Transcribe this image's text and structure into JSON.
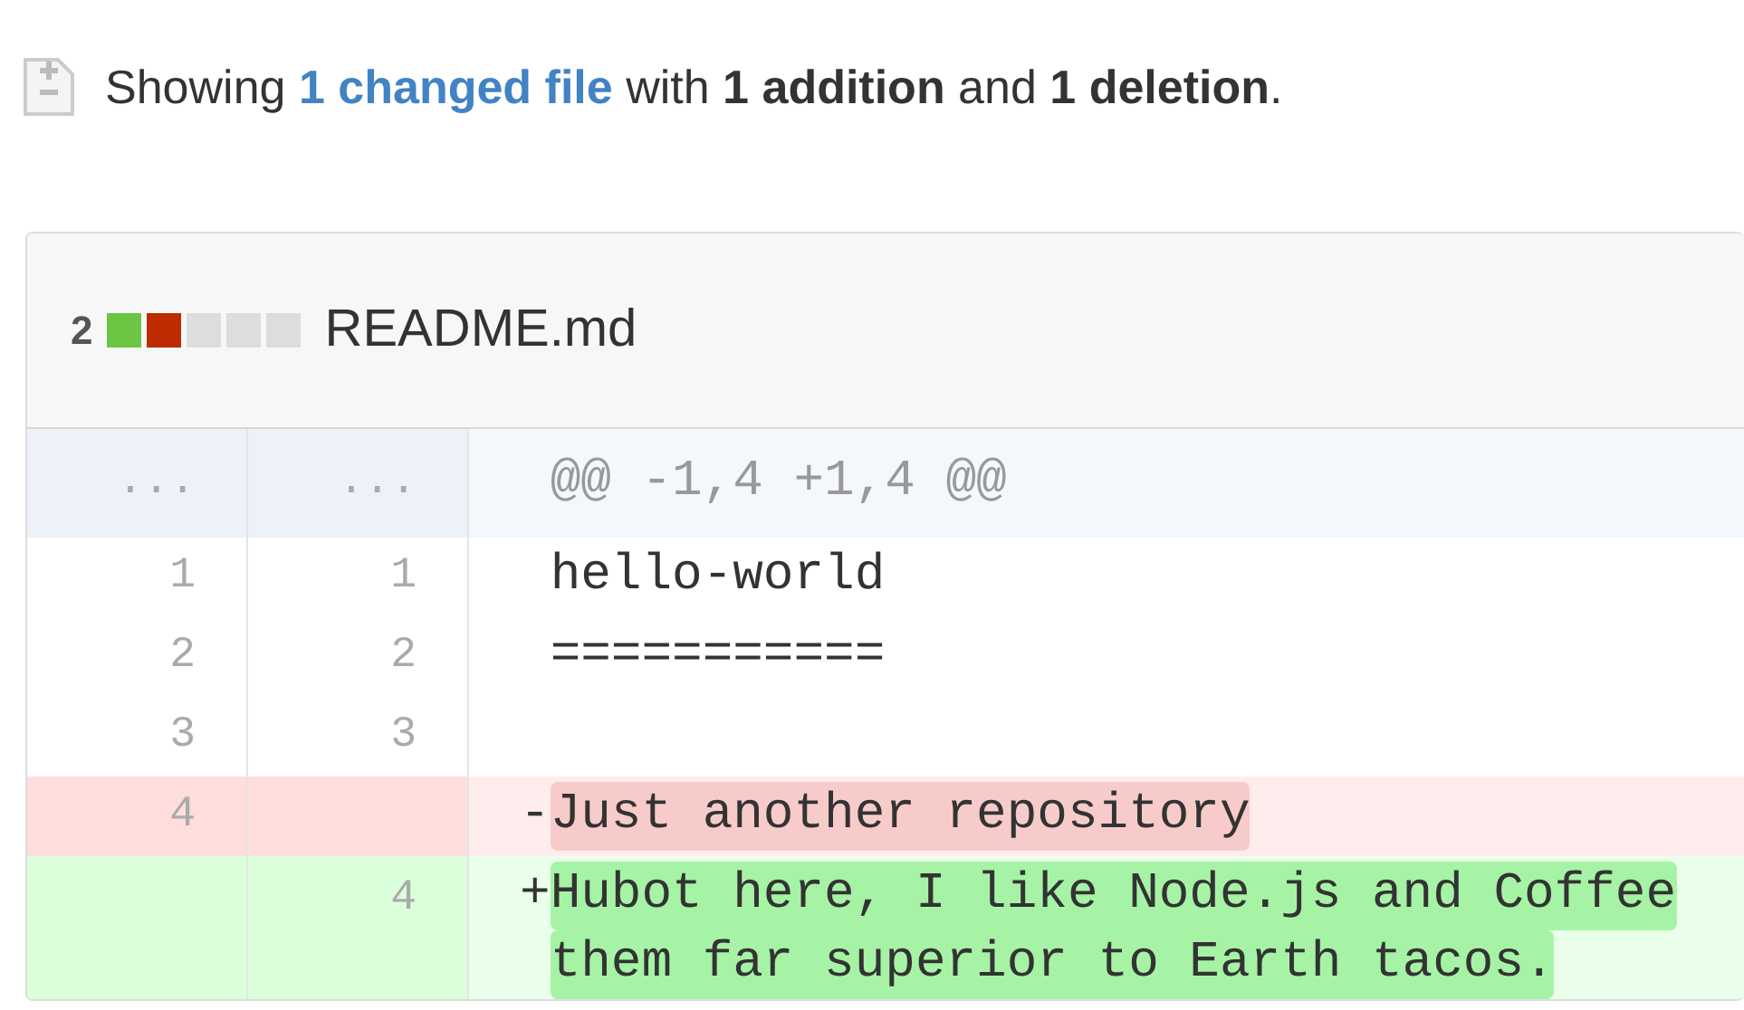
{
  "summary": {
    "prefix": "Showing",
    "link": "1 changed file",
    "suffix": "with **1 addition** and **1 deletion**."
  },
  "file": {
    "changes": "2",
    "stat_blocks": [
      {
        "kind": "addition"
      },
      {
        "kind": "deletion"
      },
      {
        "kind": "neutral"
      },
      {
        "kind": "neutral"
      },
      {
        "kind": "neutral"
      }
    ],
    "name": "README.md"
  },
  "diff_rows": [
    {
      "kind": "hunk",
      "old": "...",
      "new": "...",
      "lines": [
        "@@ -1,4 +1,4 @@"
      ]
    },
    {
      "kind": "context",
      "old": "1",
      "new": "1",
      "lines": [
        "hello-world"
      ]
    },
    {
      "kind": "context",
      "old": "2",
      "new": "2",
      "lines": [
        "==========="
      ]
    },
    {
      "kind": "context",
      "old": "3",
      "new": "3",
      "lines": []
    },
    {
      "kind": "deletion",
      "old": "4",
      "marker": "-",
      "lines": [
        "Just another repository"
      ]
    },
    {
      "kind": "addition",
      "new": "4",
      "marker": "+",
      "lines": [
        "Hubot here, I like Node.js and Coffee",
        "them far superior to Earth tacos."
      ]
    }
  ]
}
